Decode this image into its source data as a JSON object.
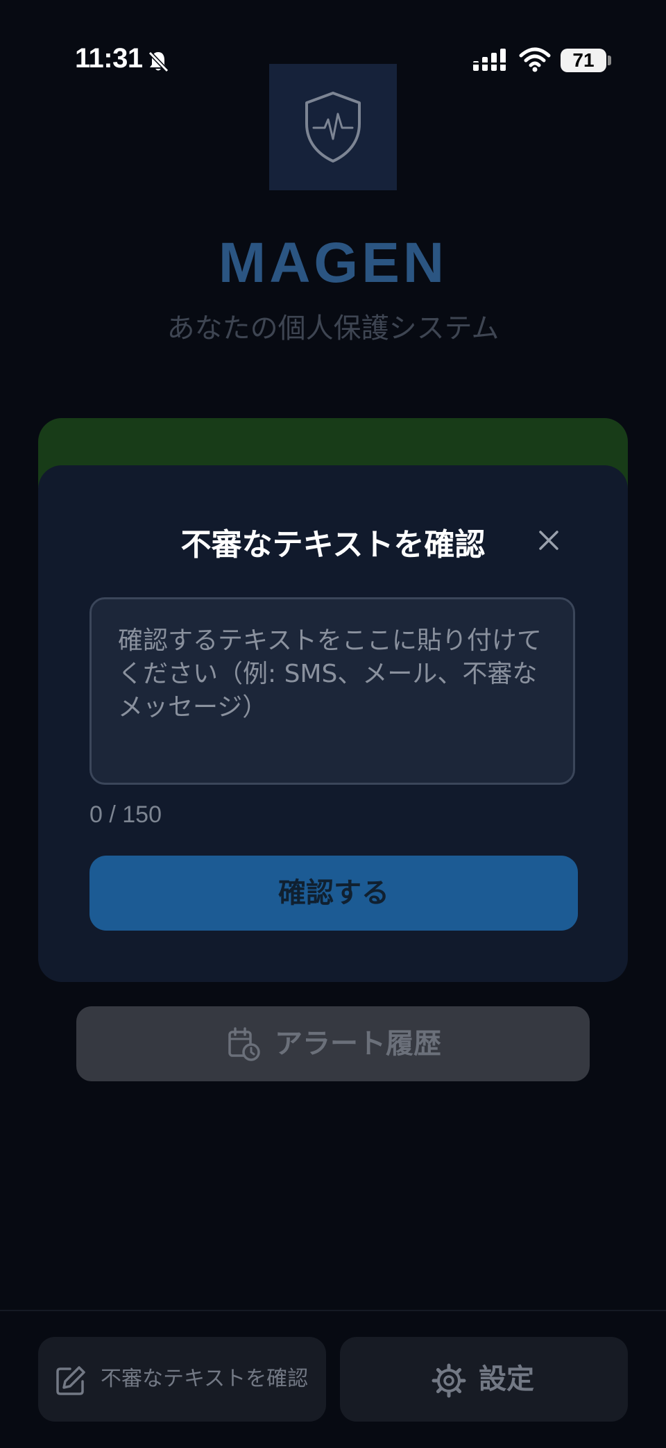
{
  "status_bar": {
    "time": "11:31",
    "battery": "71"
  },
  "app": {
    "title": "MAGEN",
    "subtitle": "あなたの個人保護システム"
  },
  "modal": {
    "title": "不審なテキストを確認",
    "placeholder": "確認するテキストをここに貼り付けてください（例: SMS、メール、不審なメッセージ）",
    "char_count": "0 / 150",
    "submit_label": "確認する"
  },
  "history_button": {
    "label": "アラート履歴"
  },
  "bottom_nav": {
    "check_label": "不審なテキストを確認",
    "settings_label": "設定"
  },
  "colors": {
    "background": "#070a12",
    "modal_background": "#111a2c",
    "accent": "#1c5b94",
    "brand_title": "#2b5582",
    "green_card": "#183c18"
  },
  "icons": {
    "logo": "shield-heartbeat-icon",
    "close": "close-icon",
    "history": "calendar-clock-icon",
    "check": "edit-icon",
    "settings": "gear-icon"
  }
}
